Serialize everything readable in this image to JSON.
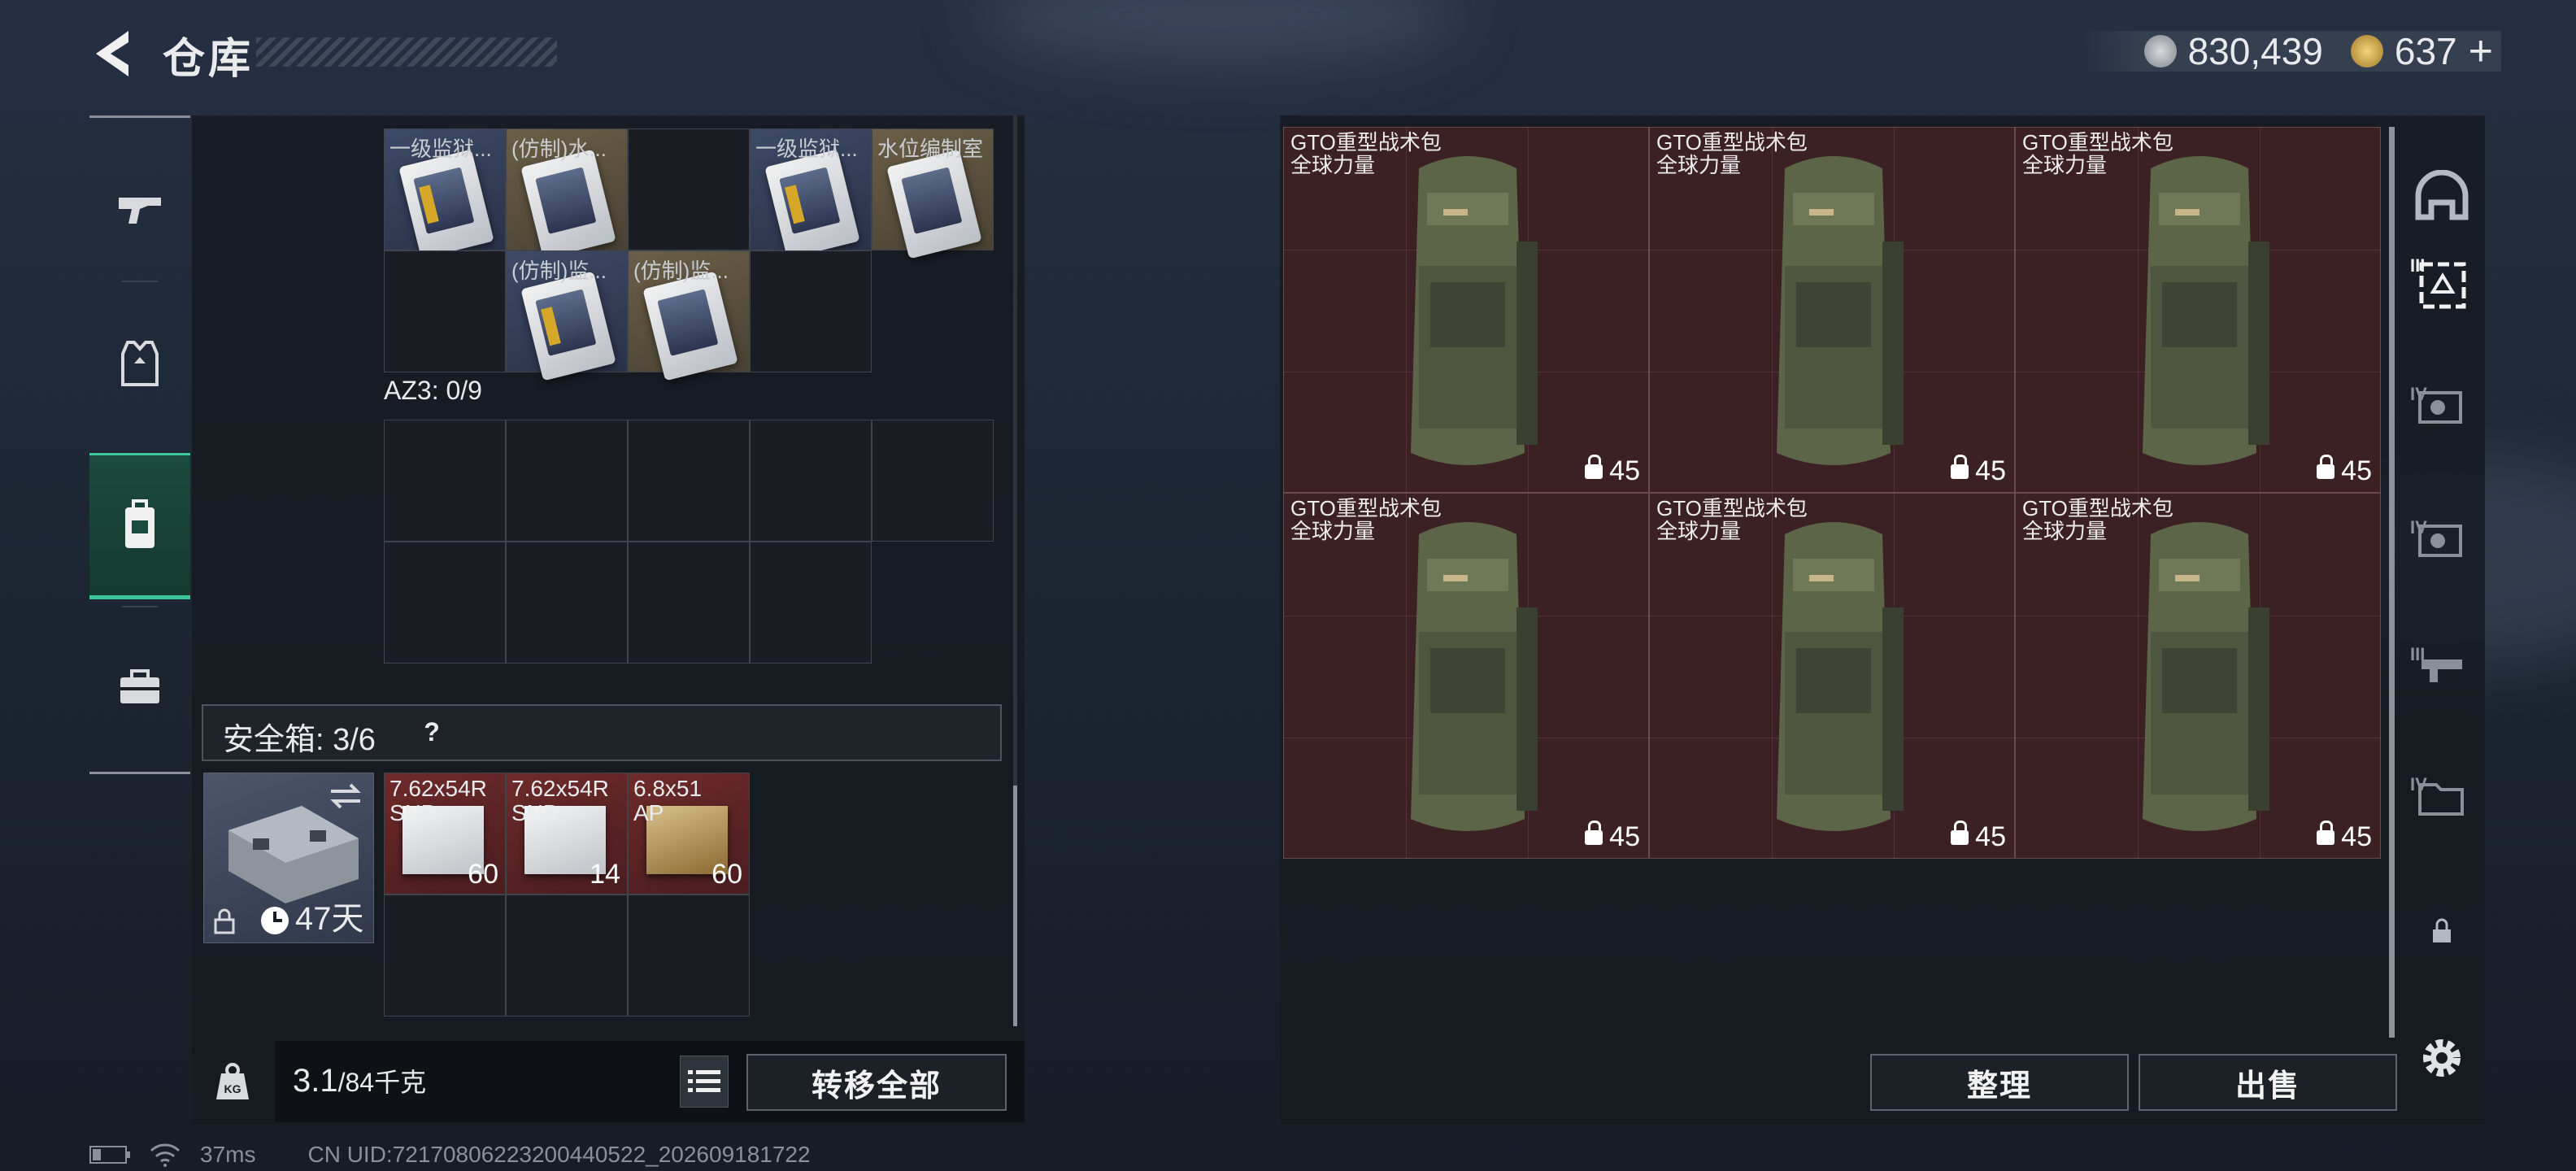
{
  "header": {
    "title": "仓库",
    "currency": {
      "silver": "830,439",
      "gold": "637",
      "plus": "+"
    }
  },
  "upper_items": [
    {
      "label": "一级监狱...",
      "bg": "blue"
    },
    {
      "label": "(仿制)水...",
      "bg": "tan"
    },
    {
      "label": "",
      "bg": "empty"
    },
    {
      "label": "一级监狱...",
      "bg": "blue"
    },
    {
      "label": "水位编制室",
      "bg": "tan"
    },
    {
      "label": "(仿制)监...",
      "bg": "blue"
    },
    {
      "label": "(仿制)监...",
      "bg": "tan"
    }
  ],
  "az3": {
    "label": "AZ3: 0/9"
  },
  "safebox": {
    "label": "安全箱: 3/6",
    "help": "?",
    "timer": "47天"
  },
  "ammo": [
    {
      "name": "7.62x54R",
      "sub": "SNB",
      "count": "60"
    },
    {
      "name": "7.62x54R",
      "sub": "SNB",
      "count": "14"
    },
    {
      "name": "6.8x51",
      "sub": "AP",
      "count": "60"
    }
  ],
  "weight": {
    "current": "3.1",
    "max": "/84千克",
    "unit_icon": "KG"
  },
  "buttons": {
    "transfer_all": "转移全部",
    "organize": "整理",
    "sell": "出售"
  },
  "bags": [
    {
      "name": "GTO重型战术包",
      "sub": "全球力量",
      "capacity": "45"
    },
    {
      "name": "GTO重型战术包",
      "sub": "全球力量",
      "capacity": "45"
    },
    {
      "name": "GTO重型战术包",
      "sub": "全球力量",
      "capacity": "45"
    },
    {
      "name": "GTO重型战术包",
      "sub": "全球力量",
      "capacity": "45"
    },
    {
      "name": "GTO重型战术包",
      "sub": "全球力量",
      "capacity": "45"
    },
    {
      "name": "GTO重型战术包",
      "sub": "全球力量",
      "capacity": "45"
    }
  ],
  "right_nav": {
    "tier3_top": "III",
    "tier4_a": "IV",
    "tier4_b": "IV",
    "tier3_b": "III",
    "tier4_c": "IV"
  },
  "footer": {
    "ping": "37ms",
    "uid": "CN UID:72170806223200440522_202609181722"
  },
  "colors": {
    "accent": "#3bc79a",
    "bag_bg": "#3c2124",
    "panel": "#161a20"
  },
  "icons": [
    "back-arrow-icon",
    "silver-coin-icon",
    "gold-coin-icon",
    "weapon-icon",
    "armor-vest-icon",
    "backpack-icon",
    "toolbox-icon",
    "swap-icon",
    "lock-icon",
    "clock-icon",
    "weight-icon",
    "list-icon",
    "helmet-icon",
    "gear-icon",
    "battery-icon",
    "wifi-icon"
  ]
}
